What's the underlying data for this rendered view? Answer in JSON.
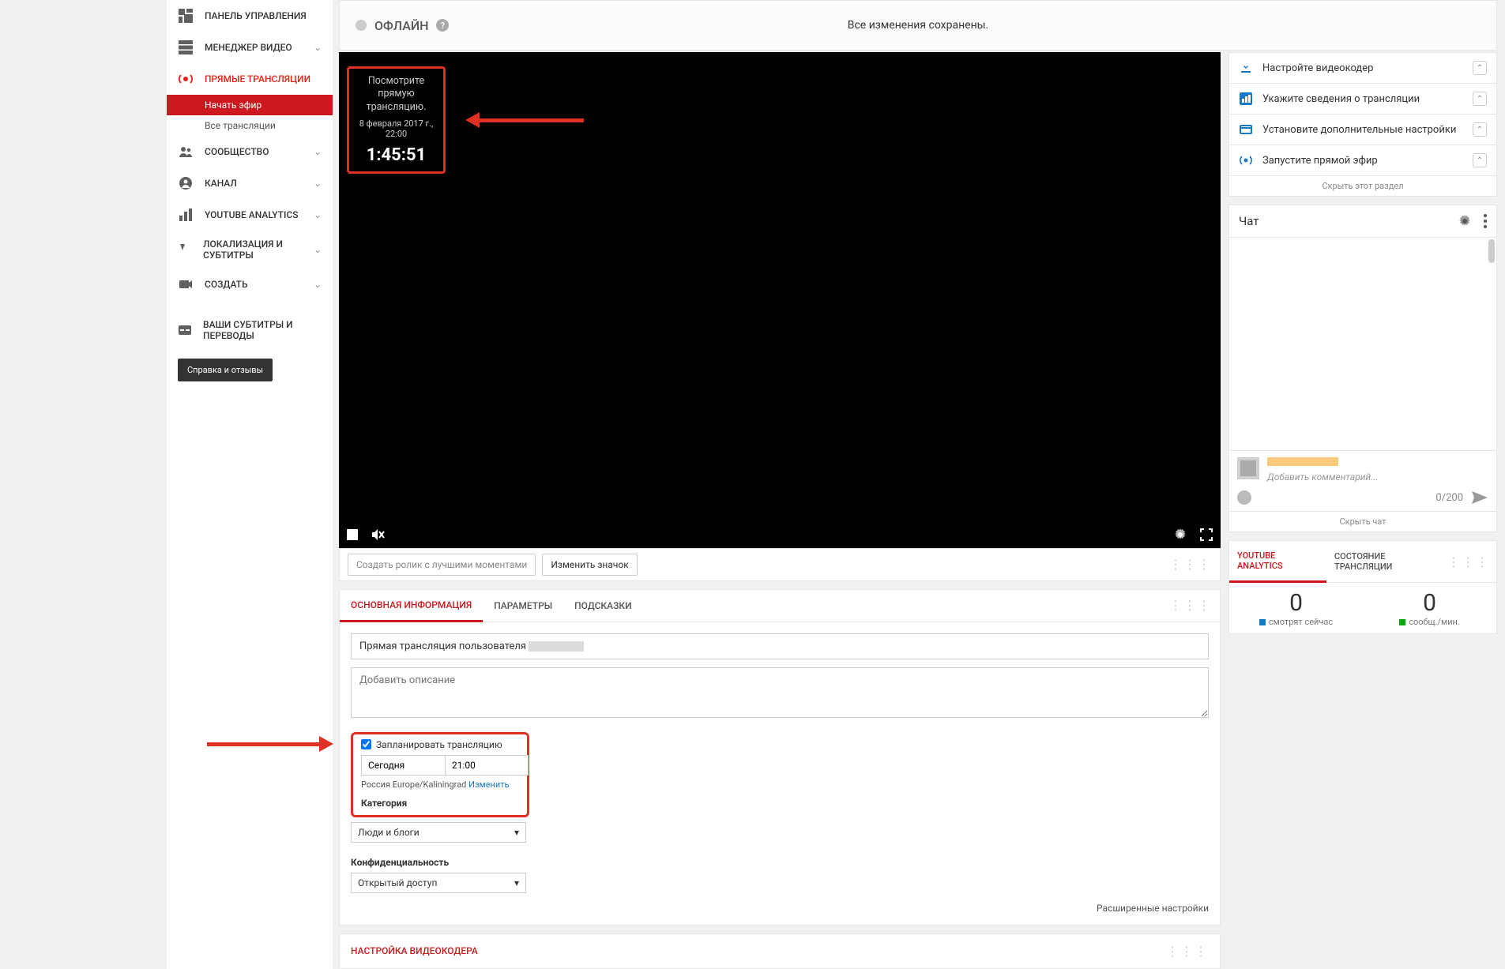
{
  "sidebar": {
    "dashboard": "ПАНЕЛЬ УПРАВЛЕНИЯ",
    "video_manager": "МЕНЕДЖЕР ВИДЕО",
    "live": "ПРЯМЫЕ ТРАНСЛЯЦИИ",
    "live_sub": {
      "start": "Начать эфир",
      "all": "Все трансляции"
    },
    "community": "СООБЩЕСТВО",
    "channel": "КАНАЛ",
    "analytics": "YOUTUBE ANALYTICS",
    "localization": "ЛОКАЛИЗАЦИЯ И СУБТИТРЫ",
    "create": "СОЗДАТЬ",
    "captions": "ВАШИ СУБТИТРЫ И ПЕРЕВОДЫ",
    "help_btn": "Справка и отзывы"
  },
  "statusbar": {
    "status": "ОФЛАЙН",
    "saved": "Все изменения сохранены."
  },
  "player_card": {
    "line1": "Посмотрите прямую трансляцию.",
    "line2": "8 февраля 2017 г., 22:00",
    "countdown": "1:45:51"
  },
  "subrow": {
    "highlights": "Создать ролик с лучшими моментами",
    "thumb": "Изменить значок"
  },
  "tabs": {
    "basic": "ОСНОВНАЯ ИНФОРМАЦИЯ",
    "params": "ПАРАМЕТРЫ",
    "hints": "ПОДСКАЗКИ"
  },
  "form": {
    "title_prefix": "Прямая трансляция пользователя ",
    "desc_placeholder": "Добавить описание",
    "schedule_cb": "Запланировать трансляцию",
    "date": "Сегодня",
    "time": "21:00",
    "tz_text": "Россия Europe/Kaliningrad ",
    "tz_change": "Изменить",
    "category_lbl": "Категория",
    "category_val": "Люди и блоги",
    "privacy_lbl": "Конфиденциальность",
    "privacy_val": "Открытый доступ",
    "advanced": "Расширенные настройки"
  },
  "encoder": {
    "title": "НАСТРОЙКА ВИДЕОКОДЕРА"
  },
  "steps": {
    "s1": "Настройте видеокодер",
    "s2": "Укажите сведения о трансляции",
    "s3": "Установите дополнительные настройки",
    "s4": "Запустите прямой эфир",
    "hide": "Скрыть этот раздел"
  },
  "chat": {
    "title": "Чат",
    "placeholder": "Добавить комментарий...",
    "counter": "0/200",
    "hide": "Скрыть чат"
  },
  "analytics": {
    "tab1": "YOUTUBE ANALYTICS",
    "tab2": "СОСТОЯНИЕ ТРАНСЛЯЦИИ",
    "viewers_num": "0",
    "viewers_lbl": "смотрят сейчас",
    "msgs_num": "0",
    "msgs_lbl": "сообщ./мин."
  }
}
